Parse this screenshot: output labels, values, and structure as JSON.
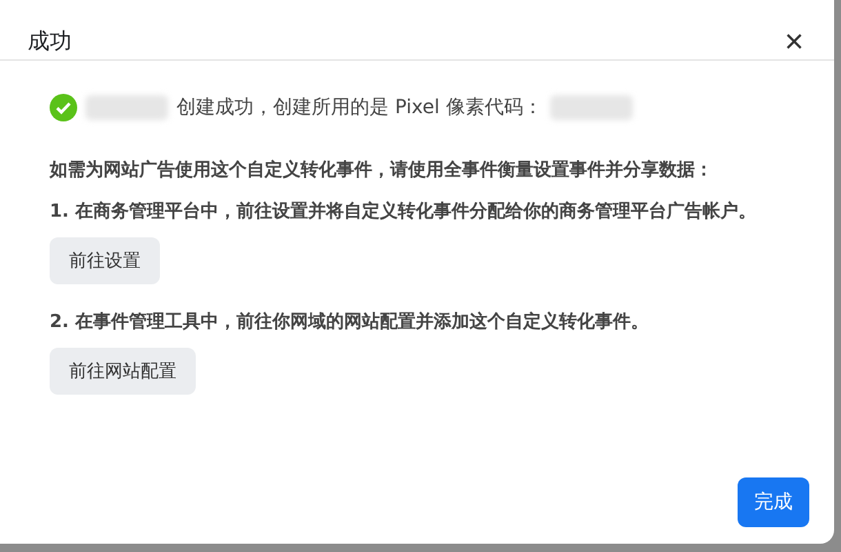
{
  "dialog": {
    "title": "成功",
    "close": "×"
  },
  "success": {
    "parts": [
      {
        "kind": "redacted"
      },
      {
        "kind": "text",
        "text": "创建成功，创建所用的是 Pixel 像素代码："
      },
      {
        "kind": "redacted"
      }
    ]
  },
  "intro": "如需为网站广告使用这个自定义转化事件，请使用全事件衡量设置事件并分享数据：",
  "steps": [
    {
      "text": "1. 在商务管理平台中，前往设置并将自定义转化事件分配给你的商务管理平台广告帐户。",
      "button": "前往设置"
    },
    {
      "text": "2. 在事件管理工具中，前往你网域的网站配置并添加这个自定义转化事件。",
      "button": "前往网站配置"
    }
  ],
  "footer": {
    "button": "完成"
  }
}
